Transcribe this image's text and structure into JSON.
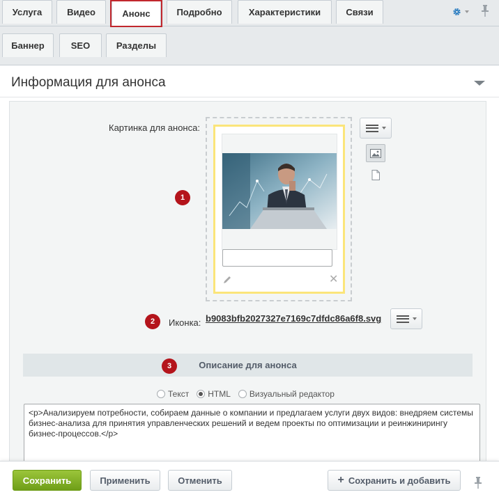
{
  "tabs": {
    "row1": [
      {
        "label": "Услуга"
      },
      {
        "label": "Видео"
      },
      {
        "label": "Анонс"
      },
      {
        "label": "Подробно"
      },
      {
        "label": "Характеристики"
      },
      {
        "label": "Связи"
      }
    ],
    "row2": [
      {
        "label": "Баннер"
      },
      {
        "label": "SEO"
      },
      {
        "label": "Разделы"
      }
    ],
    "active": "Анонс"
  },
  "section": {
    "title": "Информация для анонса"
  },
  "form": {
    "picture_label": "Картинка для анонса:",
    "icon_label": "Иконка:",
    "icon_file": "b9083bfb2027327e7169c7dfdc86a6f8.svg",
    "description_header": "Описание для анонса",
    "radios": [
      {
        "label": "Текст",
        "checked": false
      },
      {
        "label": "HTML",
        "checked": true
      },
      {
        "label": "Визуальный редактор",
        "checked": false
      }
    ],
    "description_text": "<p>Анализируем потребности, собираем данные о компании и предлагаем услуги двух видов: внедряем системы бизнес-анализа для принятия управленческих решений и ведем проекты по оптимизации и реинжинирингу бизнес-процессов.</p>"
  },
  "markers": [
    "1",
    "2",
    "3"
  ],
  "footer": {
    "save": "Сохранить",
    "apply": "Применить",
    "cancel": "Отменить",
    "save_add": "Сохранить и добавить"
  },
  "colors": {
    "highlight": "#c1272d",
    "marker": "#b4141b",
    "save_button": "#7fae22",
    "preview_border": "#fbe57a"
  },
  "icons": [
    "gear-icon",
    "pin-icon",
    "menu-icon",
    "image-icon",
    "file-icon",
    "pencil-icon",
    "close-icon",
    "plus-icon"
  ]
}
